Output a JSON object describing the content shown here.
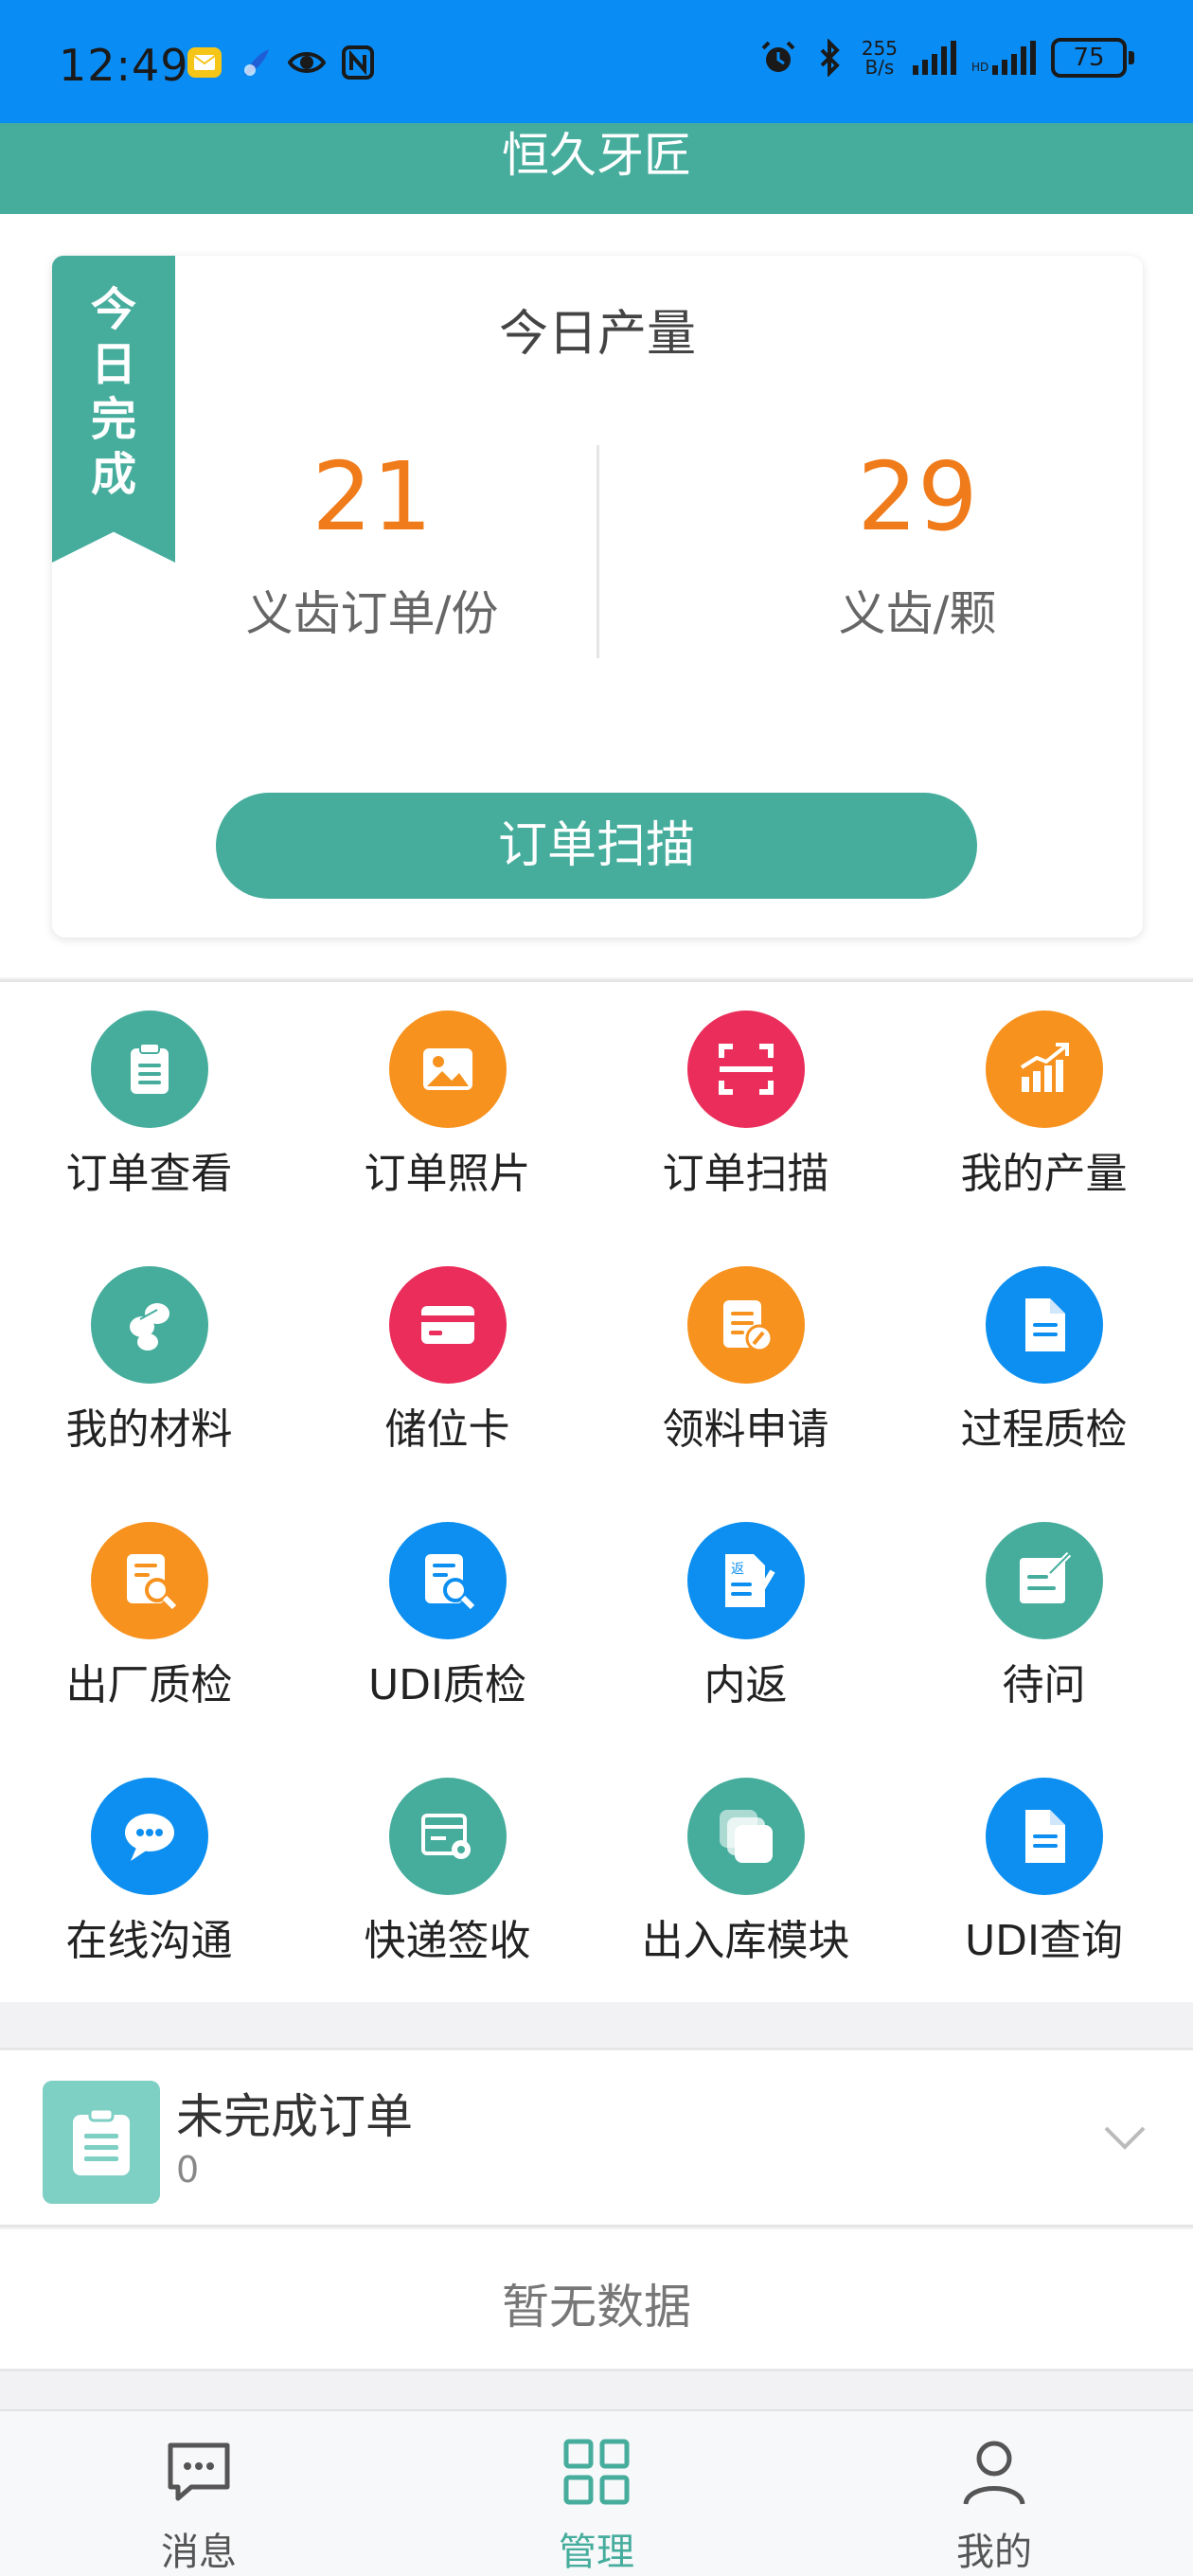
{
  "status_bar": {
    "time": "12:49",
    "net_speed_top": "255",
    "net_speed_bottom": "B/s",
    "battery": "75"
  },
  "app": {
    "title": "恒久牙匠"
  },
  "today": {
    "ribbon": "今日完成",
    "title": "今日产量",
    "orders_value": "21",
    "orders_label": "义齿订单/份",
    "teeth_value": "29",
    "teeth_label": "义齿/颗",
    "scan_button": "订单扫描"
  },
  "menu": [
    {
      "label": "订单查看",
      "icon": "clipboard-icon",
      "color": "#46ad9d"
    },
    {
      "label": "订单照片",
      "icon": "image-icon",
      "color": "#f7921e"
    },
    {
      "label": "订单扫描",
      "icon": "scan-icon",
      "color": "#ea2d5a"
    },
    {
      "label": "我的产量",
      "icon": "chart-icon",
      "color": "#f7921e"
    },
    {
      "label": "我的材料",
      "icon": "materials-icon",
      "color": "#46ad9d"
    },
    {
      "label": "储位卡",
      "icon": "card-icon",
      "color": "#ea2d5a"
    },
    {
      "label": "领料申请",
      "icon": "request-icon",
      "color": "#f7921e"
    },
    {
      "label": "过程质检",
      "icon": "document-icon",
      "color": "#0c8ff0"
    },
    {
      "label": "出厂质检",
      "icon": "inspect-icon",
      "color": "#f7921e"
    },
    {
      "label": "UDI质检",
      "icon": "inspect-icon",
      "color": "#0c8ff0"
    },
    {
      "label": "内返",
      "icon": "return-icon",
      "color": "#0c8ff0"
    },
    {
      "label": "待问",
      "icon": "note-icon",
      "color": "#46ad9d"
    },
    {
      "label": "在线沟通",
      "icon": "chat-icon",
      "color": "#0c8ff0"
    },
    {
      "label": "快递签收",
      "icon": "parcel-icon",
      "color": "#46ad9d"
    },
    {
      "label": "出入库模块",
      "icon": "stack-icon",
      "color": "#46ad9d"
    },
    {
      "label": "UDI查询",
      "icon": "document-icon",
      "color": "#0c8ff0"
    }
  ],
  "pending": {
    "title": "未完成订单",
    "count": "0",
    "empty_text": "暂无数据"
  },
  "bottom_nav": [
    {
      "label": "消息",
      "icon": "message-icon"
    },
    {
      "label": "管理",
      "icon": "grid-icon",
      "active": true
    },
    {
      "label": "我的",
      "icon": "user-icon"
    }
  ]
}
